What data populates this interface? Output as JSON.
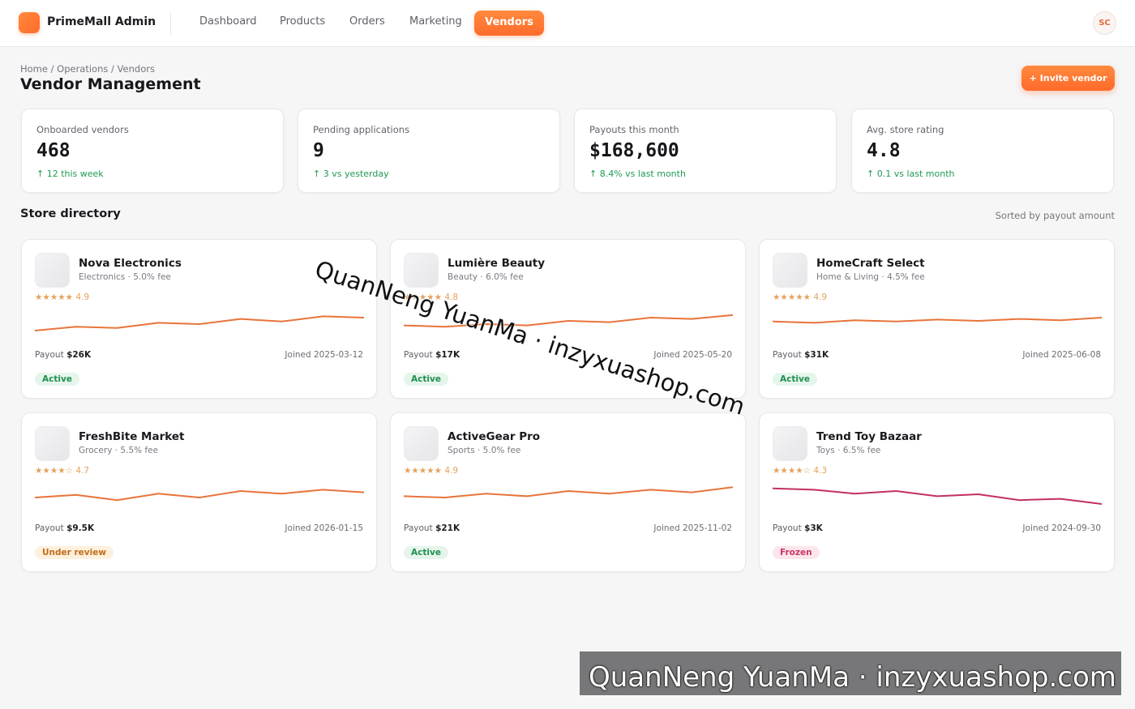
{
  "brand": {
    "name": "PrimeMall Admin"
  },
  "nav": {
    "items": [
      "Dashboard",
      "Products",
      "Orders",
      "Marketing"
    ],
    "active": "Vendors"
  },
  "user": {
    "initials": "SC"
  },
  "breadcrumb": "Home / Operations / Vendors",
  "page": {
    "title": "Vendor Management"
  },
  "actions": {
    "invite": "+ Invite vendor"
  },
  "kpis": [
    {
      "label": "Onboarded vendors",
      "value": "468",
      "delta": "↑ 12 this week"
    },
    {
      "label": "Pending applications",
      "value": "9",
      "delta": "↑ 3 vs yesterday"
    },
    {
      "label": "Payouts this month",
      "value": "$168,600",
      "delta": "↑ 8.4% vs last month"
    },
    {
      "label": "Avg. store rating",
      "value": "4.8",
      "delta": "↑ 0.1 vs last month"
    }
  ],
  "directory": {
    "title": "Store directory",
    "note": "Sorted by payout amount",
    "payout_label": "Payout",
    "vendors": [
      {
        "name": "Nova Electronics",
        "meta": "Electronics · 5.0% fee",
        "rating": "★★★★★ 4.9",
        "payout": "$26K",
        "joined": "Joined 2025-03-12",
        "status": "Active",
        "trend": [
          30,
          36,
          34,
          42,
          40,
          48,
          44,
          52,
          50
        ]
      },
      {
        "name": "Lumière Beauty",
        "meta": "Beauty · 6.0% fee",
        "rating": "★★★★★ 4.8",
        "payout": "$17K",
        "joined": "Joined 2025-05-20",
        "status": "Active",
        "trend": [
          38,
          36,
          40,
          38,
          45,
          43,
          50,
          48,
          54
        ]
      },
      {
        "name": "HomeCraft Select",
        "meta": "Home & Living · 4.5% fee",
        "rating": "★★★★★ 4.9",
        "payout": "$31K",
        "joined": "Joined 2025-06-08",
        "status": "Active",
        "trend": [
          44,
          42,
          46,
          44,
          47,
          45,
          48,
          46,
          50
        ]
      },
      {
        "name": "FreshBite Market",
        "meta": "Grocery · 5.5% fee",
        "rating": "★★★★☆ 4.7",
        "payout": "$9.5K",
        "joined": "Joined 2026-01-15",
        "status": "Under review",
        "trend": [
          40,
          44,
          36,
          46,
          40,
          50,
          46,
          52,
          48
        ]
      },
      {
        "name": "ActiveGear Pro",
        "meta": "Sports · 5.0% fee",
        "rating": "★★★★★ 4.9",
        "payout": "$21K",
        "joined": "Joined 2025-11-02",
        "status": "Active",
        "trend": [
          42,
          40,
          46,
          42,
          50,
          46,
          52,
          48,
          56
        ]
      },
      {
        "name": "Trend Toy Bazaar",
        "meta": "Toys · 6.5% fee",
        "rating": "★★★★☆ 4.3",
        "payout": "$3K",
        "joined": "Joined 2024-09-30",
        "status": "Frozen",
        "trend": [
          54,
          52,
          46,
          50,
          42,
          45,
          36,
          38,
          30
        ]
      }
    ]
  },
  "colors": {
    "accent": "#ff6b2c",
    "spark_normal": "#e8743a",
    "spark_frozen": "#c2305e"
  },
  "watermark": "QuanNeng YuanMa · inzyxuashop.com"
}
